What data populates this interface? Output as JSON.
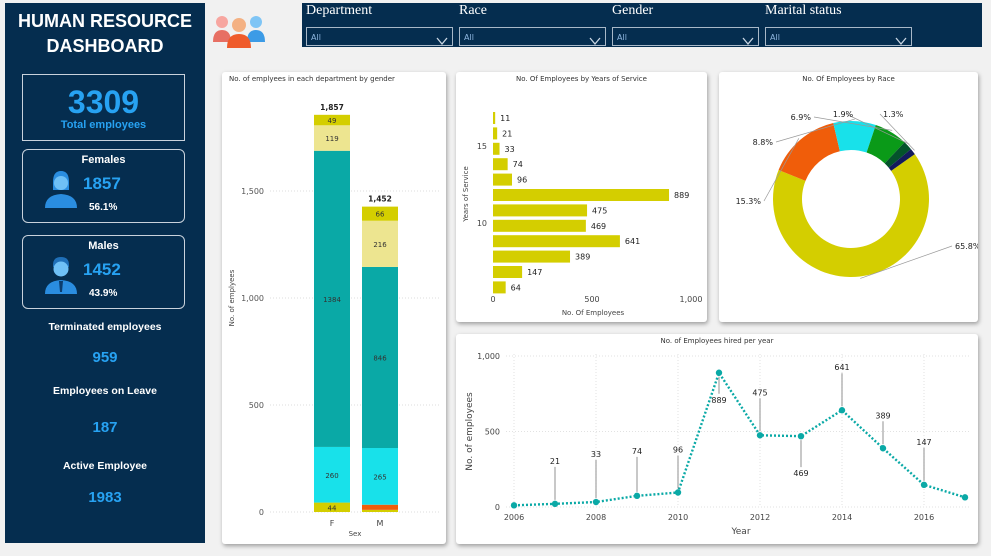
{
  "header": {
    "title_line1": "HUMAN RESOURCE",
    "title_line2": "DASHBOARD"
  },
  "kpis": {
    "total_value": "3309",
    "total_label": "Total employees",
    "females_label": "Females",
    "females_value": "1857",
    "females_pct": "56.1%",
    "males_label": "Males",
    "males_value": "1452",
    "males_pct": "43.9%",
    "terminated_label": "Terminated employees",
    "terminated_value": "959",
    "leave_label": "Employees on Leave",
    "leave_value": "187",
    "active_label": "Active Employee",
    "active_value": "1983"
  },
  "filters": [
    {
      "label": "Department",
      "value": "All"
    },
    {
      "label": "Race",
      "value": "All"
    },
    {
      "label": "Gender",
      "value": "All"
    },
    {
      "label": "Marital status",
      "value": "All"
    }
  ],
  "colors": {
    "panel": "#052d4f",
    "accent": "#27a2f2",
    "teal": "#0aa9a6",
    "cyan": "#18e1ea",
    "olive": "#d4ce00",
    "pale": "#ede590",
    "orange": "#f05d0a",
    "green": "#0a9a18",
    "darkgreen": "#04532b",
    "navy": "#131a5c"
  },
  "icons": [
    "people-group-icon",
    "female-user-icon",
    "male-user-icon",
    "chevron-down-icon"
  ],
  "chart_data": [
    {
      "type": "bar",
      "stacked": true,
      "title": "No. of emplyees in each department by gender",
      "xlabel": "Sex",
      "ylabel": "No. of emplyees",
      "categories": [
        "F",
        "M"
      ],
      "totals": [
        "1,857",
        "1,452"
      ],
      "ylim": [
        0,
        2000
      ],
      "yticks": [
        "0",
        "500",
        "1,000",
        "1,500"
      ],
      "series": [
        {
          "values": [
            44,
            10
          ],
          "labels": [
            "44",
            ""
          ],
          "color": "#d4ce00"
        },
        {
          "values": [
            0,
            24
          ],
          "labels": [
            "",
            ""
          ],
          "color": "#f05d0a"
        },
        {
          "values": [
            260,
            265
          ],
          "labels": [
            "260",
            "265"
          ],
          "color": "#18e1ea"
        },
        {
          "values": [
            1384,
            846
          ],
          "labels": [
            "1384",
            "846"
          ],
          "color": "#0aa9a6"
        },
        {
          "values": [
            119,
            216
          ],
          "labels": [
            "119",
            "216"
          ],
          "color": "#ede590"
        },
        {
          "values": [
            49,
            66
          ],
          "labels": [
            "49",
            "66"
          ],
          "color": "#d4ce00"
        }
      ]
    },
    {
      "type": "bar",
      "orientation": "horizontal",
      "title": "No. Of Employees by Years of Service",
      "xlabel": "No. Of Employees",
      "ylabel": "Years of Service",
      "yticks": [
        "15",
        "10"
      ],
      "xticks": [
        "0",
        "500",
        "1,000"
      ],
      "xlim": [
        0,
        1000
      ],
      "values": [
        11,
        21,
        33,
        74,
        96,
        889,
        475,
        469,
        641,
        389,
        147,
        64
      ],
      "color": "#d4ce00"
    },
    {
      "type": "pie",
      "donut": true,
      "title": "No. Of Employees by Race",
      "slices": [
        {
          "value": 65.8,
          "label": "65.8%",
          "color": "#d4ce00"
        },
        {
          "value": 15.3,
          "label": "15.3%",
          "color": "#f05d0a"
        },
        {
          "value": 8.8,
          "label": "8.8%",
          "color": "#18e1ea"
        },
        {
          "value": 6.9,
          "label": "6.9%",
          "color": "#0a9a18"
        },
        {
          "value": 1.9,
          "label": "1.9%",
          "color": "#04532b"
        },
        {
          "value": 1.3,
          "label": "1.3%",
          "color": "#131a5c"
        }
      ]
    },
    {
      "type": "line",
      "title": "No. of Employees hired per year",
      "xlabel": "Year",
      "ylabel": "No. of employees",
      "x": [
        2006,
        2007,
        2008,
        2009,
        2010,
        2011,
        2012,
        2013,
        2014,
        2015,
        2016,
        2017
      ],
      "y": [
        11,
        21,
        33,
        74,
        96,
        889,
        475,
        469,
        641,
        389,
        147,
        64
      ],
      "labels": [
        "",
        "21",
        "33",
        "74",
        "96",
        "889",
        "475",
        "469",
        "641",
        "389",
        "147",
        ""
      ],
      "xticks": [
        "2006",
        "2008",
        "2010",
        "2012",
        "2014",
        "2016"
      ],
      "yticks": [
        "0",
        "500",
        "1,000"
      ],
      "ylim": [
        0,
        1000
      ],
      "color": "#0aa9a6"
    }
  ]
}
